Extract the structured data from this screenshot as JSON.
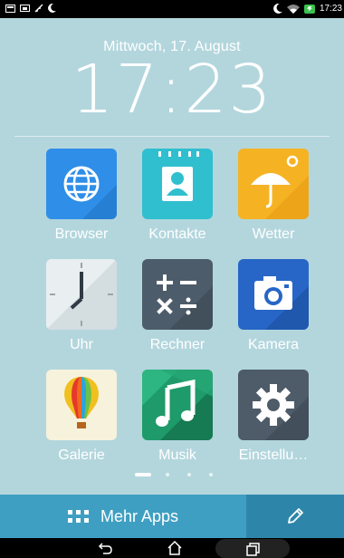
{
  "status_bar": {
    "time": "17:23",
    "left_icons": [
      "notification-icon",
      "cast-icon",
      "alarm-icon",
      "moon-icon"
    ],
    "right_icons": [
      "moon-icon",
      "wifi-icon",
      "battery-charging-icon"
    ]
  },
  "lockscreen": {
    "date": "Mittwoch, 17. August",
    "clock": "17:23"
  },
  "apps": [
    {
      "label": "Browser",
      "icon": "globe-icon",
      "color": "#2f8ee8"
    },
    {
      "label": "Kontakte",
      "icon": "person-icon",
      "color": "#2fbfcf"
    },
    {
      "label": "Wetter",
      "icon": "umbrella-sun-icon",
      "color": "#f5b324"
    },
    {
      "label": "Uhr",
      "icon": "clock-icon",
      "color": "#e9eef0"
    },
    {
      "label": "Rechner",
      "icon": "calculator-icon",
      "color": "#4d5c6a"
    },
    {
      "label": "Kamera",
      "icon": "camera-icon",
      "color": "#2766c6"
    },
    {
      "label": "Galerie",
      "icon": "balloon-icon",
      "color": "#f7f2dc"
    },
    {
      "label": "Musik",
      "icon": "music-note-icon",
      "color": "#1f9a6a"
    },
    {
      "label": "Einstellu…",
      "icon": "gear-icon",
      "color": "#4e5b68"
    }
  ],
  "page_indicator": {
    "pages": 4,
    "current": 1
  },
  "dock": {
    "more_apps_label": "Mehr Apps",
    "edit_icon": "pencil-icon"
  },
  "nav_bar": {
    "buttons": [
      "back-icon",
      "home-icon",
      "recent-apps-icon"
    ]
  }
}
